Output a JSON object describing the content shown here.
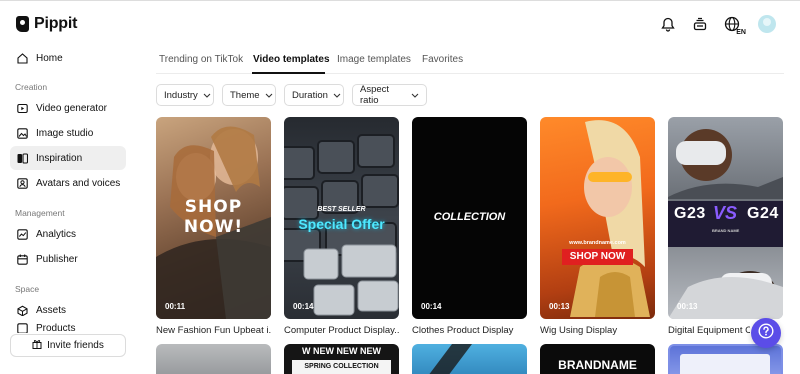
{
  "app": {
    "name": "Pippit"
  },
  "top_icons": [
    "bell-icon",
    "inbox-icon",
    "globe-icon",
    "avatar"
  ],
  "language": "EN",
  "sidebar": {
    "home": "Home",
    "sections": [
      {
        "label": "Creation",
        "items": [
          "Video generator",
          "Image studio",
          "Inspiration",
          "Avatars and voices"
        ]
      },
      {
        "label": "Management",
        "items": [
          "Analytics",
          "Publisher"
        ]
      },
      {
        "label": "Space",
        "items": [
          "Assets",
          "Products"
        ]
      }
    ],
    "active_item": "Inspiration",
    "invite_label": "Invite friends"
  },
  "tabs": [
    "Trending on TikTok",
    "Video templates",
    "Image templates",
    "Favorites"
  ],
  "active_tab": "Video templates",
  "filters": [
    "Industry",
    "Theme",
    "Duration",
    "Aspect ratio"
  ],
  "cards": [
    {
      "title": "New Fashion Fun Upbeat i...",
      "duration": "00:11",
      "overlay": "SHOP NOW!"
    },
    {
      "title": "Computer Product Display...",
      "duration": "00:14",
      "overlay_top": "BEST SELLER",
      "overlay": "Special Offer"
    },
    {
      "title": "Clothes Product Display",
      "duration": "00:14",
      "overlay": "COLLECTION"
    },
    {
      "title": "Wig Using Display",
      "duration": "00:13",
      "overlay_top": "www.brandname.com",
      "overlay": "SHOP NOW"
    },
    {
      "title": "Digital Equipment Co...",
      "duration": "00:13",
      "overlay_left": "G23",
      "overlay_mid": "VS",
      "overlay_right": "G24",
      "overlay_sub": "BRAND NAME"
    }
  ],
  "row2_cards": [
    {
      "overlay": ""
    },
    {
      "overlay_top": "W NEW NEW NEW",
      "overlay": "SPRING COLLECTION"
    },
    {
      "overlay": ""
    },
    {
      "overlay": "BRANDNAME"
    },
    {
      "overlay": ""
    }
  ],
  "colors": {
    "accent": "#5b4de8",
    "shop_red": "#e02020",
    "vs_purple": "#8a5cff",
    "offer_cyan": "#4ee8ff"
  }
}
